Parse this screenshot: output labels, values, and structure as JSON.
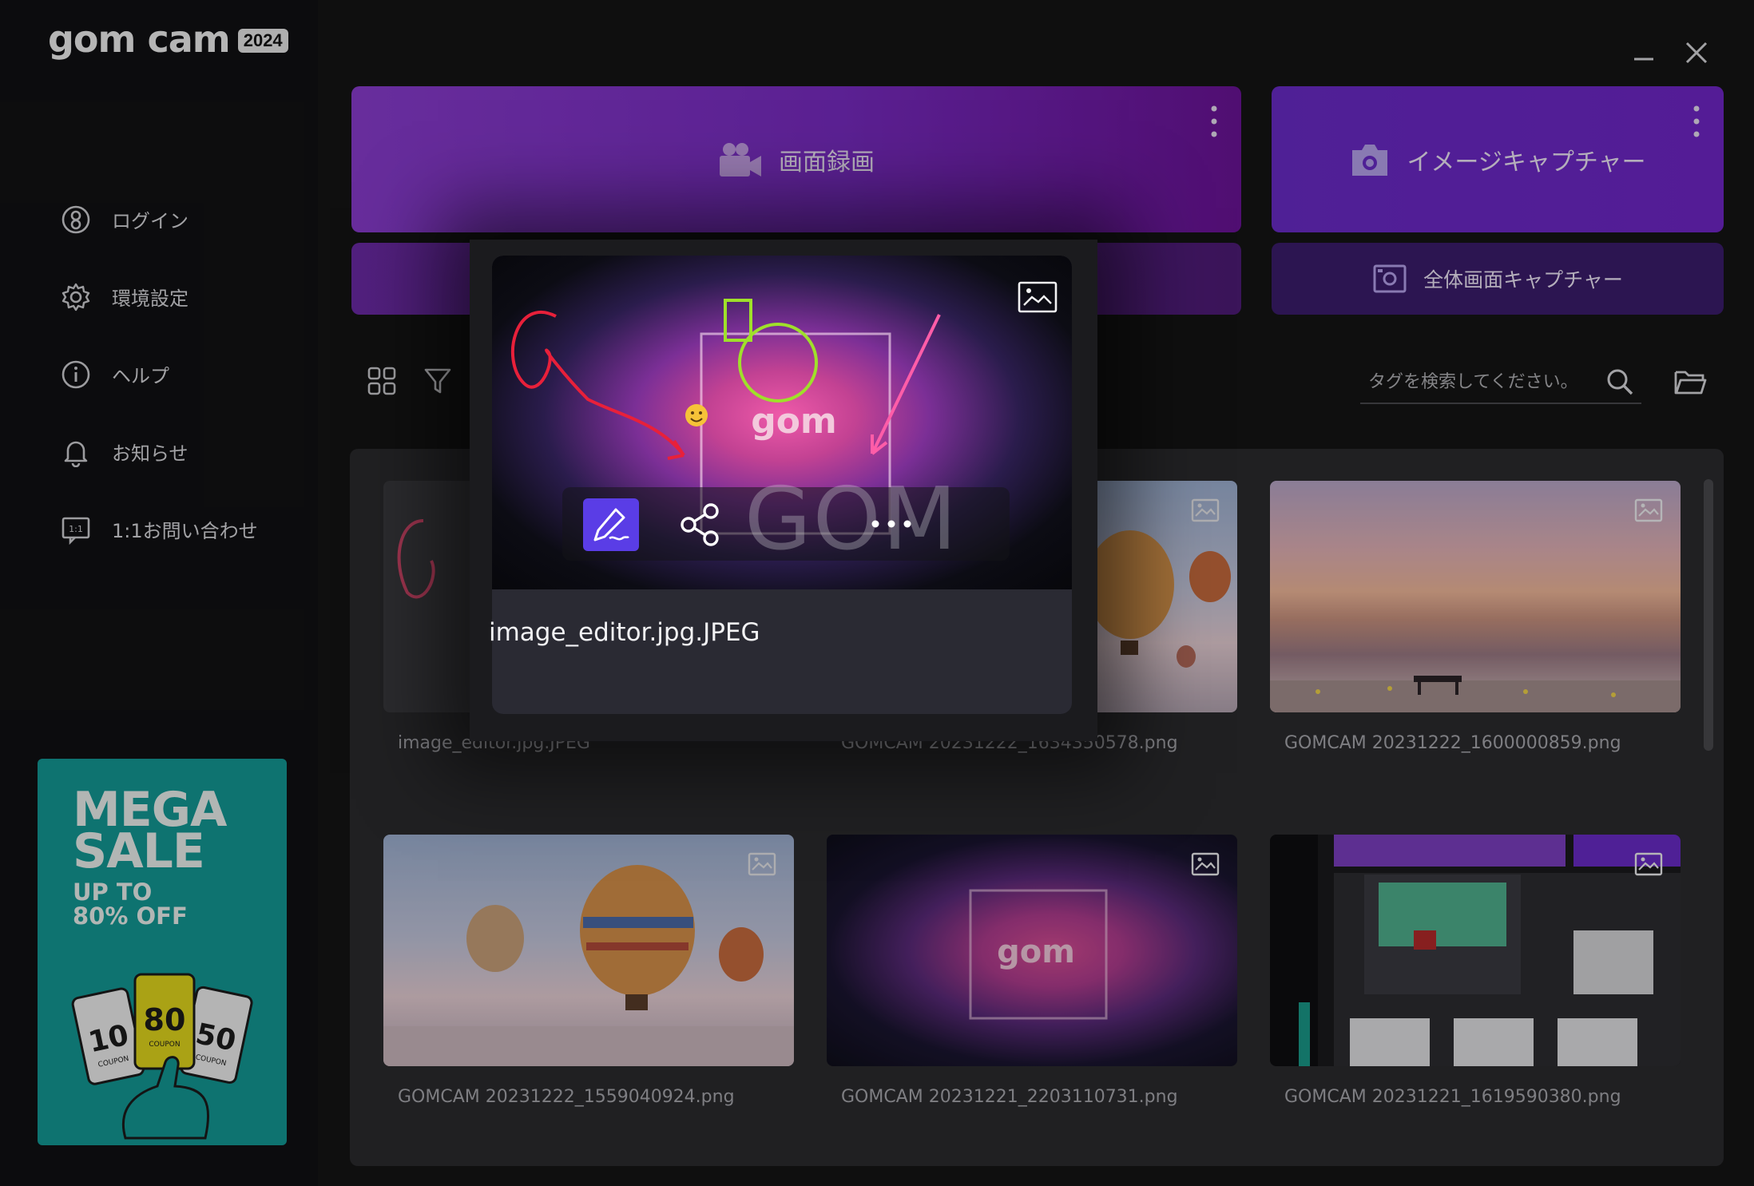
{
  "app": {
    "logo": "gom cam",
    "year": "2024"
  },
  "sidebar": {
    "items": [
      {
        "label": "ログイン",
        "icon": "user-circle-icon"
      },
      {
        "label": "環境設定",
        "icon": "gear-icon"
      },
      {
        "label": "ヘルプ",
        "icon": "info-icon"
      },
      {
        "label": "お知らせ",
        "icon": "bell-icon"
      },
      {
        "label": "1:1お問い合わせ",
        "icon": "chat-icon"
      }
    ],
    "promo": {
      "title_line1": "MEGA",
      "title_line2": "SALE",
      "sub_line1": "UP TO",
      "sub_line2": "80% OFF",
      "coupons": [
        "10",
        "80",
        "50"
      ],
      "coupon_word": "COUPON"
    }
  },
  "capture": {
    "record_label": "画面録画",
    "image_label": "イメージキャプチャー",
    "fullscreen_label": "全体画面キャプチャー"
  },
  "toolbar": {
    "search_placeholder": "タグを検索してください。"
  },
  "gallery": {
    "files": [
      {
        "name": "image_editor.jpg.JPEG"
      },
      {
        "name": "GOMCAM 20231222_1634350578.png"
      },
      {
        "name": "GOMCAM 20231222_1600000859.png"
      },
      {
        "name": "GOMCAM 20231222_1559040924.png"
      },
      {
        "name": "GOMCAM 20231221_2203110731.png"
      },
      {
        "name": "GOMCAM 20231221_1619590380.png"
      }
    ]
  },
  "popup": {
    "file_name": "image_editor.jpg.JPEG",
    "watermark": "GOM",
    "thumb_logo": "gom"
  },
  "colors": {
    "accent_purple": "#7a2cc4",
    "edit_button": "#5a3de6",
    "promo_teal": "#139a96"
  }
}
